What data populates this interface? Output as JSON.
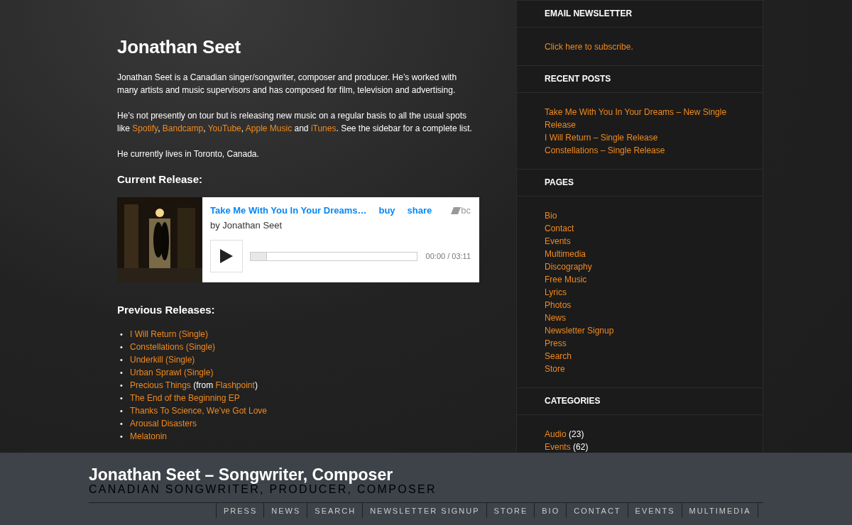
{
  "main": {
    "title": "Jonathan Seet",
    "paragraphs": [
      [
        {
          "text": "Jonathan Seet is a Canadian singer/songwriter, composer and producer.  He’s worked with many artists and music supervisors and has composed for film, television and advertising.",
          "kind": "text"
        }
      ],
      [
        {
          "text": "He’s not presently on tour but is releasing new music on a regular basis to all the usual spots like ",
          "kind": "text"
        },
        {
          "text": "Spotify",
          "kind": "link"
        },
        {
          "text": ", ",
          "kind": "text"
        },
        {
          "text": "Bandcamp",
          "kind": "link"
        },
        {
          "text": ", ",
          "kind": "text"
        },
        {
          "text": "YouTube",
          "kind": "link"
        },
        {
          "text": ", ",
          "kind": "text"
        },
        {
          "text": "Apple Music",
          "kind": "link"
        },
        {
          "text": " and ",
          "kind": "text"
        },
        {
          "text": "iTunes",
          "kind": "link"
        },
        {
          "text": ".  See the sidebar for a complete list.",
          "kind": "text"
        }
      ],
      [
        {
          "text": "He currently lives in Toronto, Canada.",
          "kind": "text"
        }
      ]
    ],
    "current_heading": "Current Release:",
    "player": {
      "title": "Take Me With You In Your Dreams…",
      "buy": "buy",
      "share": "share",
      "logo": "bc",
      "artist": "by Jonathan Seet",
      "time": "00:00 / 03:11",
      "level": 0
    },
    "previous_heading": "Previous Releases:",
    "releases": [
      {
        "marker": "•",
        "parts": [
          {
            "text": "I Will Return (Single)",
            "kind": "link"
          }
        ]
      },
      {
        "marker": "•",
        "parts": [
          {
            "text": "Constellations (Single)",
            "kind": "link"
          }
        ]
      },
      {
        "marker": "•",
        "parts": [
          {
            "text": "Underkill (Single)",
            "kind": "link"
          }
        ]
      },
      {
        "marker": "•",
        "parts": [
          {
            "text": "Urban Sprawl (Single)",
            "kind": "link"
          }
        ]
      },
      {
        "marker": "•",
        "parts": [
          {
            "text": "Precious Things",
            "kind": "link"
          },
          {
            "text": " (from ",
            "kind": "text"
          },
          {
            "text": "Flashpoint",
            "kind": "link"
          },
          {
            "text": ")",
            "kind": "text"
          }
        ]
      },
      {
        "marker": "•",
        "parts": [
          {
            "text": "The End of the Beginning EP",
            "kind": "link"
          }
        ]
      },
      {
        "marker": "•",
        "parts": [
          {
            "text": "Thanks To Science, We’ve Got Love",
            "kind": "link"
          }
        ]
      },
      {
        "marker": "•",
        "parts": [
          {
            "text": "Arousal Disasters",
            "kind": "link"
          }
        ]
      },
      {
        "marker": "•",
        "parts": [
          {
            "text": "Melatonin",
            "kind": "link"
          }
        ]
      }
    ]
  },
  "sidebar": [
    {
      "heading": "EMAIL NEWSLETTER",
      "links": [
        {
          "label": "Click here to subscribe."
        }
      ]
    },
    {
      "heading": "RECENT POSTS",
      "links": [
        {
          "label": "Take Me With You In Your Dreams – New Single Release"
        },
        {
          "label": "I Will Return – Single Release"
        },
        {
          "label": "Constellations – Single Release"
        }
      ]
    },
    {
      "heading": "PAGES",
      "links": [
        {
          "label": "Bio"
        },
        {
          "label": "Contact"
        },
        {
          "label": "Events"
        },
        {
          "label": "Multimedia"
        },
        {
          "label": "Discography"
        },
        {
          "label": "Free Music"
        },
        {
          "label": "Lyrics"
        },
        {
          "label": "Photos"
        },
        {
          "label": "News"
        },
        {
          "label": "Newsletter Signup"
        },
        {
          "label": "Press"
        },
        {
          "label": "Search"
        },
        {
          "label": "Store"
        }
      ]
    },
    {
      "heading": "CATEGORIES",
      "links": [
        {
          "label": "Audio",
          "count": "(23)"
        },
        {
          "label": "Events",
          "count": "(62)"
        }
      ]
    }
  ],
  "footer": {
    "site_title": "Jonathan Seet – Songwriter, Composer",
    "tagline": "CANADIAN SONGWRITER, PRODUCER, COMPOSER",
    "nav": [
      "PRESS",
      "NEWS",
      "SEARCH",
      "NEWSLETTER SIGNUP",
      "STORE",
      "BIO",
      "CONTACT",
      "EVENTS",
      "MULTIMEDIA"
    ]
  }
}
